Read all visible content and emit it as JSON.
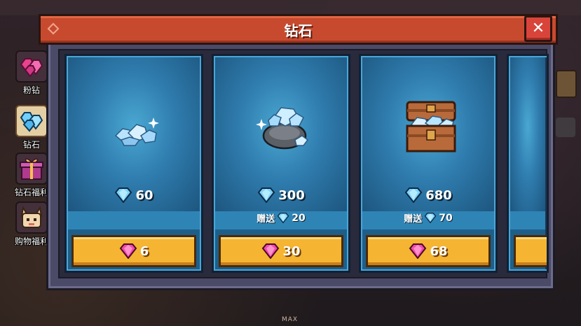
{
  "dialog": {
    "title": "钻石",
    "close_label": "✕"
  },
  "side_tabs": [
    {
      "label": "粉钻",
      "icon": "pink-diamond-pile-icon",
      "active": false
    },
    {
      "label": "钻石",
      "icon": "blue-diamond-pile-icon",
      "active": true
    },
    {
      "label": "钻石福利",
      "icon": "gift-box-icon",
      "active": false
    },
    {
      "label": "购物福利",
      "icon": "cat-mascot-icon",
      "active": false
    }
  ],
  "products": [
    {
      "image_icon": "small-diamond-pile-icon",
      "amount": "60",
      "bonus_label": "",
      "bonus": "",
      "price": "6"
    },
    {
      "image_icon": "diamond-sack-icon",
      "amount": "300",
      "bonus_label": "赠送",
      "bonus": "20",
      "price": "30"
    },
    {
      "image_icon": "diamond-chest-icon",
      "amount": "680",
      "bonus_label": "赠送",
      "bonus": "70",
      "price": "68"
    }
  ],
  "background": {
    "max_label": "MAX"
  },
  "colors": {
    "title_bar": "#c84a2e",
    "card_bg": "#2f7cae",
    "price_button": "#f5b431",
    "blue_gem": "#7fd3ff",
    "pink_gem": "#f24aa8"
  }
}
